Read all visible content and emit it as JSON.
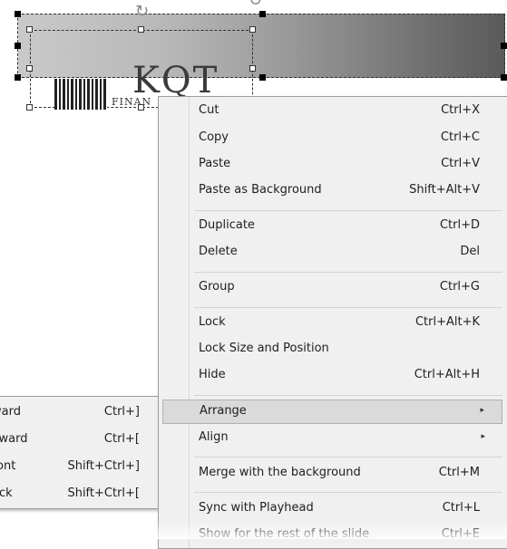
{
  "logo": {
    "text": "KQT",
    "subtext": "FINAN"
  },
  "context_menu": {
    "items": [
      {
        "label": "Cut",
        "shortcut": "Ctrl+X"
      },
      {
        "label": "Copy",
        "shortcut": "Ctrl+C"
      },
      {
        "label": "Paste",
        "shortcut": "Ctrl+V"
      },
      {
        "label": "Paste as Background",
        "shortcut": "Shift+Alt+V"
      },
      {
        "label": "Duplicate",
        "shortcut": "Ctrl+D"
      },
      {
        "label": "Delete",
        "shortcut": "Del"
      },
      {
        "label": "Group",
        "shortcut": "Ctrl+G"
      },
      {
        "label": "Lock",
        "shortcut": "Ctrl+Alt+K"
      },
      {
        "label": "Lock Size and Position",
        "shortcut": ""
      },
      {
        "label": "Hide",
        "shortcut": "Ctrl+Alt+H"
      },
      {
        "label": "Arrange",
        "shortcut": "",
        "submenu_arrow": "▸"
      },
      {
        "label": "Align",
        "shortcut": "",
        "submenu_arrow": "▸"
      },
      {
        "label": "Merge with the background",
        "shortcut": "Ctrl+M"
      },
      {
        "label": "Sync with Playhead",
        "shortcut": "Ctrl+L"
      },
      {
        "label": "Show for the rest of the slide",
        "shortcut": "Ctrl+E"
      }
    ],
    "highlighted": "Arrange"
  },
  "arrange_submenu": {
    "items": [
      {
        "label": "ward",
        "shortcut": "Ctrl+]"
      },
      {
        "label": "kward",
        "shortcut": "Ctrl+["
      },
      {
        "label": "ront",
        "shortcut": "Shift+Ctrl+]"
      },
      {
        "label": "ack",
        "shortcut": "Shift+Ctrl+["
      }
    ]
  },
  "colors": {
    "menu_bg": "#f0f0f0",
    "highlight_bg": "#dadada",
    "border": "#9c9c9c"
  }
}
